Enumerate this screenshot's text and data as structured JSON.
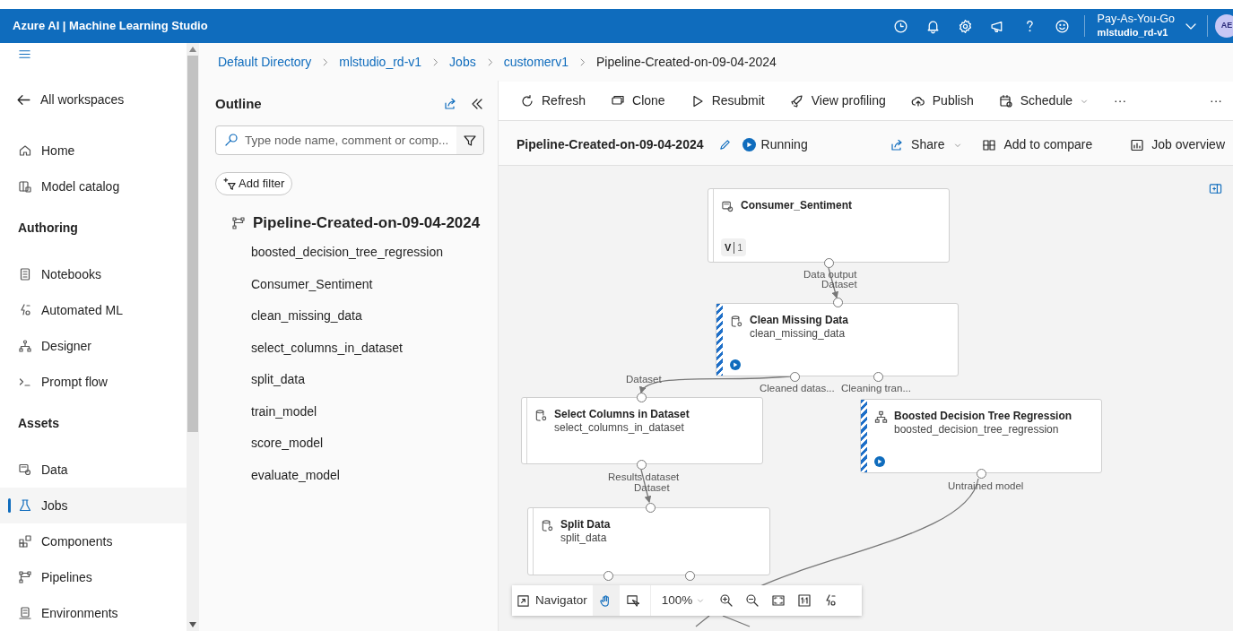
{
  "header": {
    "title": "Azure AI | Machine Learning Studio",
    "subscription": "Pay-As-You-Go",
    "workspace": "mlstudio_rd-v1",
    "avatar": "AE"
  },
  "nav": [
    {
      "kind": "menu"
    },
    {
      "kind": "back",
      "label": "All workspaces"
    },
    {
      "kind": "item",
      "label": "Home",
      "selected": false
    },
    {
      "kind": "item",
      "label": "Model catalog",
      "selected": false
    },
    {
      "kind": "heading",
      "label": "Authoring"
    },
    {
      "kind": "item",
      "label": "Notebooks",
      "selected": false
    },
    {
      "kind": "item",
      "label": "Automated ML",
      "selected": false
    },
    {
      "kind": "item",
      "label": "Designer",
      "selected": false
    },
    {
      "kind": "item",
      "label": "Prompt flow",
      "selected": false
    },
    {
      "kind": "heading",
      "label": "Assets"
    },
    {
      "kind": "item",
      "label": "Data",
      "selected": false
    },
    {
      "kind": "item",
      "label": "Jobs",
      "selected": true
    },
    {
      "kind": "item",
      "label": "Components",
      "selected": false
    },
    {
      "kind": "item",
      "label": "Pipelines",
      "selected": false
    },
    {
      "kind": "item",
      "label": "Environments",
      "selected": false
    }
  ],
  "breadcrumbs": [
    "Default Directory",
    "mlstudio_rd-v1",
    "Jobs",
    "customerv1",
    "Pipeline-Created-on-09-04-2024"
  ],
  "outline": {
    "title": "Outline",
    "search": {
      "placeholder": "Type node name, comment or comp..."
    },
    "add_filter": "Add filter",
    "root": "Pipeline-Created-on-09-04-2024",
    "children": [
      "boosted_decision_tree_regression",
      "Consumer_Sentiment",
      "clean_missing_data",
      "select_columns_in_dataset",
      "split_data",
      "train_model",
      "score_model",
      "evaluate_model"
    ]
  },
  "toolbar": [
    {
      "label": "Refresh",
      "dropdown": false
    },
    {
      "label": "Clone",
      "dropdown": false
    },
    {
      "label": "Resubmit",
      "dropdown": false
    },
    {
      "label": "View profiling",
      "dropdown": false
    },
    {
      "label": "Publish",
      "dropdown": false
    },
    {
      "label": "Schedule",
      "dropdown": true
    },
    {
      "label": "···",
      "dropdown": false
    }
  ],
  "toolbar_more": "···",
  "job": {
    "title": "Pipeline-Created-on-09-04-2024",
    "status": "Running",
    "actions": [
      {
        "label": "Share",
        "dropdown": true
      },
      {
        "label": "Add to compare",
        "dropdown": false
      },
      {
        "label": "Job overview",
        "dropdown": false
      }
    ]
  },
  "nodes": [
    {
      "title": "Consumer_Sentiment",
      "running": false,
      "badge": {
        "label": "V",
        "value": "1"
      }
    },
    {
      "title": "Clean Missing Data",
      "subtitle": "clean_missing_data",
      "running": true
    },
    {
      "title": "Select Columns in Dataset",
      "subtitle": "select_columns_in_dataset",
      "running": false
    },
    {
      "title": "Boosted Decision Tree Regression",
      "subtitle": "boosted_decision_tree_regression",
      "running": true
    },
    {
      "title": "Split Data",
      "subtitle": "split_data",
      "running": false
    }
  ],
  "port_labels": [
    "Data output",
    "Dataset",
    "Dataset",
    "Cleaned datas...",
    "Cleaning tran...",
    "Results dataset",
    "Dataset",
    "Untrained model"
  ],
  "navigator": {
    "label": "Navigator",
    "zoom": "100%"
  }
}
